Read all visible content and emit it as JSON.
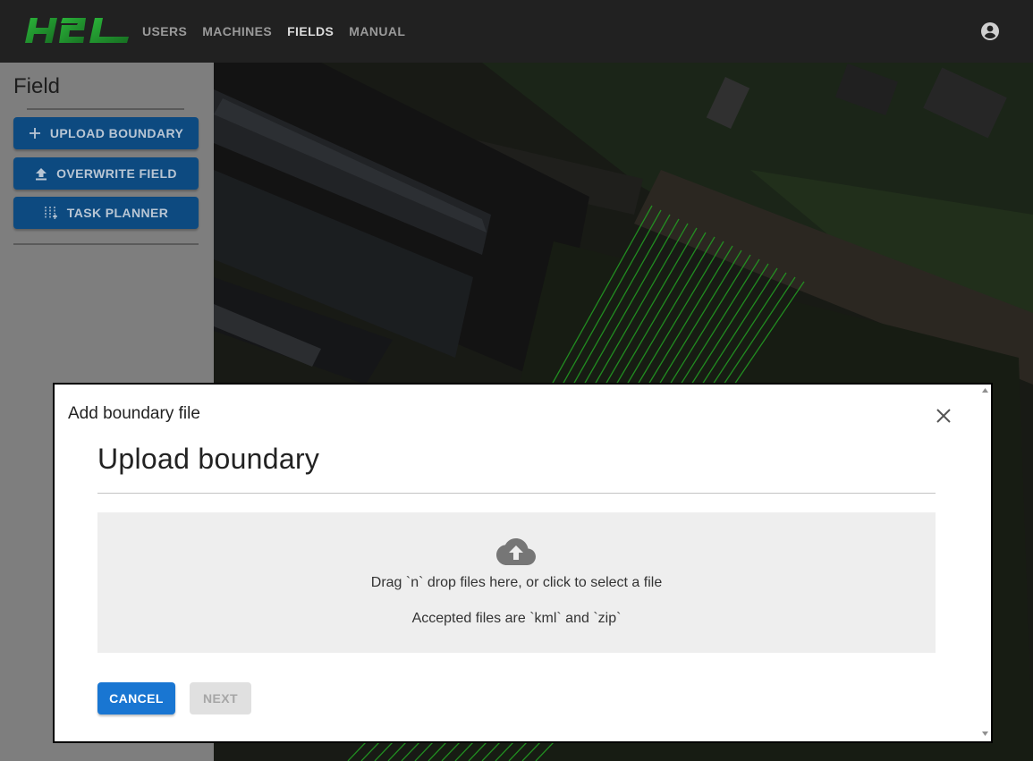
{
  "appbar": {
    "logo_text": "H2L",
    "nav": [
      {
        "label": "USERS",
        "active": false
      },
      {
        "label": "MACHINES",
        "active": false
      },
      {
        "label": "FIELDS",
        "active": true
      },
      {
        "label": "MANUAL",
        "active": false
      }
    ],
    "account_icon": "account-circle-icon"
  },
  "sidebar": {
    "title": "Field",
    "buttons": [
      {
        "label": "UPLOAD BOUNDARY",
        "icon": "plus-icon"
      },
      {
        "label": "OVERWRITE FIELD",
        "icon": "upload-icon"
      },
      {
        "label": "TASK PLANNER",
        "icon": "tune-icon"
      }
    ]
  },
  "dialog": {
    "title": "Add boundary file",
    "heading": "Upload boundary",
    "dropzone": {
      "icon": "cloud-upload-icon",
      "line1": "Drag `n` drop files here, or click to select a file",
      "line2": "Accepted files are `kml` and `zip`"
    },
    "cancel_label": "CANCEL",
    "next_label": "NEXT",
    "next_disabled": true
  },
  "colors": {
    "primary": "#1976d2",
    "appbar": "#212121",
    "logo_green": "#1f9e2d",
    "field_lines": "#2fd52f"
  }
}
